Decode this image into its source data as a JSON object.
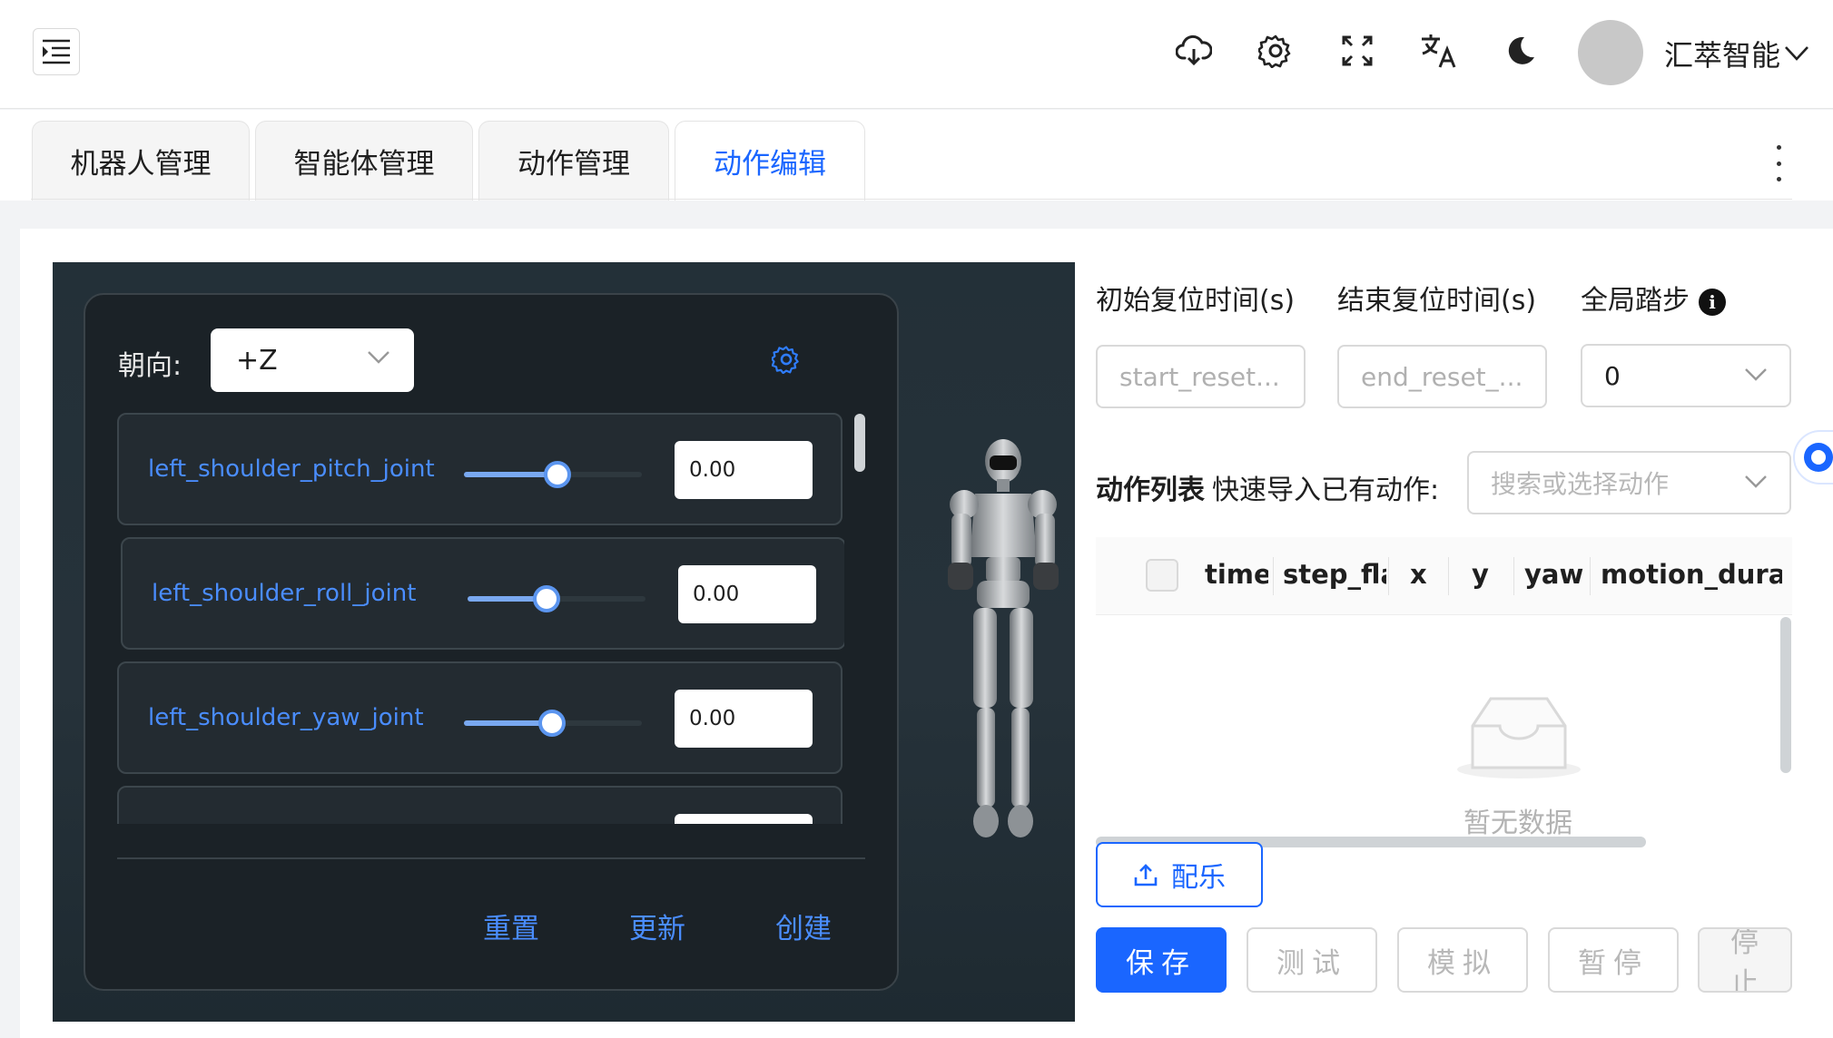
{
  "header": {
    "icons": [
      "cloud-download-icon",
      "gear-icon",
      "fullscreen-icon",
      "translate-icon",
      "moon-icon"
    ],
    "user_name": "汇萃智能"
  },
  "tabs": [
    {
      "label": "机器人管理",
      "active": false
    },
    {
      "label": "智能体管理",
      "active": false
    },
    {
      "label": "动作管理",
      "active": false
    },
    {
      "label": "动作编辑",
      "active": true
    }
  ],
  "joint_panel": {
    "direction_label": "朝向:",
    "direction_value": "+Z",
    "joints": [
      {
        "name": "left_shoulder_pitch_joint",
        "value": "0.00",
        "slider": 0.5
      },
      {
        "name": "left_shoulder_roll_joint",
        "value": "0.00",
        "slider": 0.5
      },
      {
        "name": "left_shoulder_yaw_joint",
        "value": "0.00",
        "slider": 0.5
      }
    ],
    "buttons": {
      "reset": "重置",
      "update": "更新",
      "create": "创建"
    }
  },
  "form": {
    "start_reset_label": "初始复位时间(s)",
    "start_reset_placeholder": "start_reset...",
    "end_reset_label": "结束复位时间(s)",
    "end_reset_placeholder": "end_reset_...",
    "global_step_label": "全局踏步",
    "global_step_value": "0"
  },
  "action_list": {
    "title": "动作列表",
    "import_label": "快速导入已有动作:",
    "import_placeholder": "搜索或选择动作",
    "columns": [
      "time",
      "step_flag",
      "x",
      "y",
      "yaw",
      "motion_dura"
    ],
    "empty_text": "暂无数据"
  },
  "buttons": {
    "music": "配乐",
    "save": "保存",
    "test": "测试",
    "simulate": "模拟",
    "pause": "暂停",
    "stop": "停止"
  },
  "colors": {
    "accent": "#1a66ff",
    "joint_name": "#4a8dff",
    "scene_bg": "#233038"
  }
}
